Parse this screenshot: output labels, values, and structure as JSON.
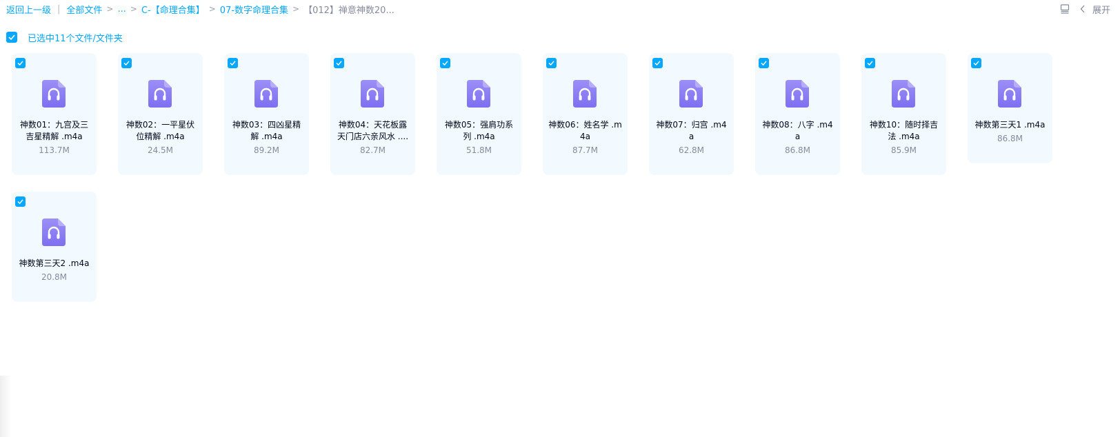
{
  "breadcrumb": {
    "back": "返回上一级",
    "sep": "|",
    "all_files": "全部文件",
    "ellipsis": "...",
    "gt": ">",
    "level1": "C-【命理合集】",
    "level2": "07-数字命理合集",
    "current": "【012】禅意神数20..."
  },
  "toolbar": {
    "list_view_icon": "list-view-icon",
    "expand_label": "展开"
  },
  "selection": {
    "label": "已选中11个文件/文件夹",
    "checked": true
  },
  "colors": {
    "accent": "#06a7ff",
    "card_bg": "#f2f9ff",
    "icon_purple": "#8a7cf2"
  },
  "files": [
    {
      "name": "神数01：九宫及三吉星精解 .m4a",
      "size": "113.7M",
      "icon": "audio-file-icon",
      "checked": true
    },
    {
      "name": "神数02：一平星伏位精解 .m4a",
      "size": "24.5M",
      "icon": "audio-file-icon",
      "checked": true
    },
    {
      "name": "神数03：四凶星精解 .m4a",
      "size": "89.2M",
      "icon": "audio-file-icon",
      "checked": true
    },
    {
      "name": "神数04：天花板露天门店六亲风水 ....",
      "size": "82.7M",
      "icon": "audio-file-icon",
      "checked": true
    },
    {
      "name": "神数05：强肩功系列 .m4a",
      "size": "51.8M",
      "icon": "audio-file-icon",
      "checked": true
    },
    {
      "name": "神数06：姓名学 .m4a",
      "size": "87.7M",
      "icon": "audio-file-icon",
      "checked": true
    },
    {
      "name": "神数07：归宫 .m4a",
      "size": "62.8M",
      "icon": "audio-file-icon",
      "checked": true
    },
    {
      "name": "神数08：八字 .m4a",
      "size": "86.8M",
      "icon": "audio-file-icon",
      "checked": true
    },
    {
      "name": "神数10：随时择吉法 .m4a",
      "size": "85.9M",
      "icon": "audio-file-icon",
      "checked": true
    },
    {
      "name": "神数第三天1 .m4a",
      "size": "86.8M",
      "icon": "audio-file-icon",
      "checked": true
    },
    {
      "name": "神数第三天2 .m4a",
      "size": "20.8M",
      "icon": "audio-file-icon",
      "checked": true
    }
  ]
}
